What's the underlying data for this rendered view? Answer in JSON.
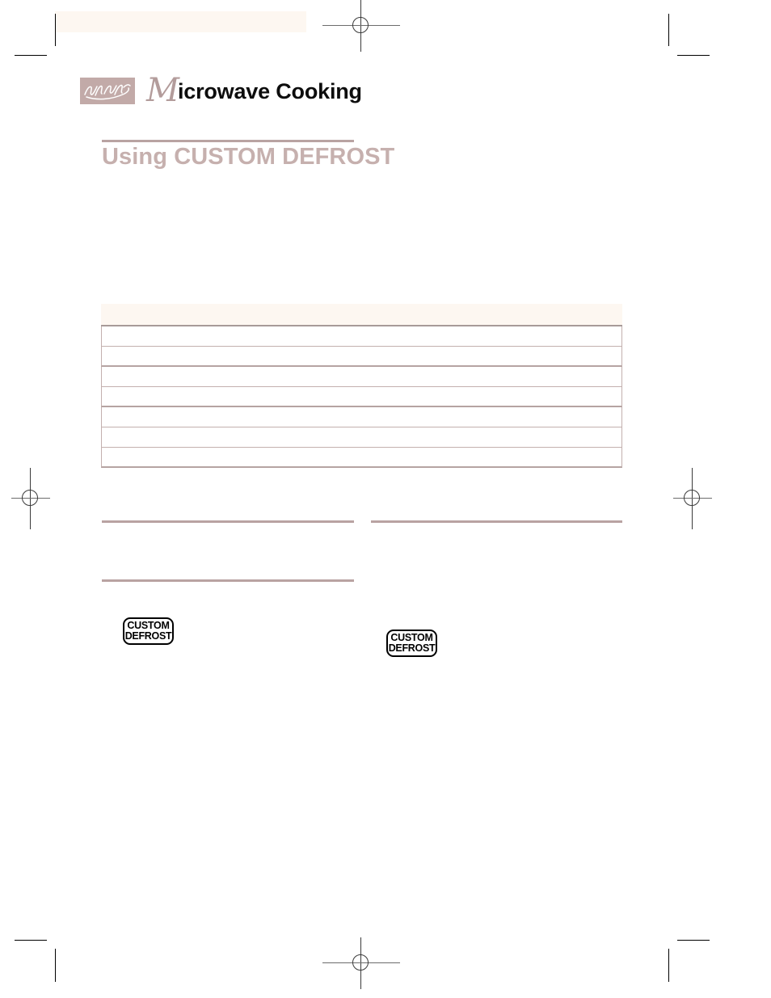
{
  "page": {
    "header_title_initial": "M",
    "header_title_rest": "icrowave Cooking",
    "section_title": "Using CUSTOM DEFROST",
    "logo_name": "whirlpool-script-logo"
  },
  "table": {
    "headers": [
      "",
      "",
      ""
    ],
    "rows": [
      {
        "cells": [
          "",
          "",
          ""
        ]
      },
      {
        "cells": [
          "",
          "",
          ""
        ]
      },
      {
        "cells": [
          "",
          "",
          ""
        ]
      },
      {
        "cells": [
          "",
          "",
          ""
        ]
      },
      {
        "cells": [
          "",
          "",
          ""
        ]
      },
      {
        "cells": [
          "",
          "",
          ""
        ]
      },
      {
        "cells": [
          "",
          "",
          ""
        ]
      }
    ]
  },
  "columns": {
    "left_heading": "",
    "left_body": "",
    "right_heading": "",
    "right_body": "",
    "left_sub_heading": "",
    "left_sub_body": ""
  },
  "buttons": {
    "custom_defrost_1": {
      "line1": "CUSTOM",
      "line2": "DEFROST"
    },
    "custom_defrost_2": {
      "line1": "CUSTOM",
      "line2": "DEFROST"
    }
  },
  "colors": {
    "accent_mauve": "#c6b0ae",
    "rule_mauve": "#b9a3a2",
    "cream": "#fdf7f1",
    "table_border": "#c3b0ae",
    "ink": "#000000"
  }
}
